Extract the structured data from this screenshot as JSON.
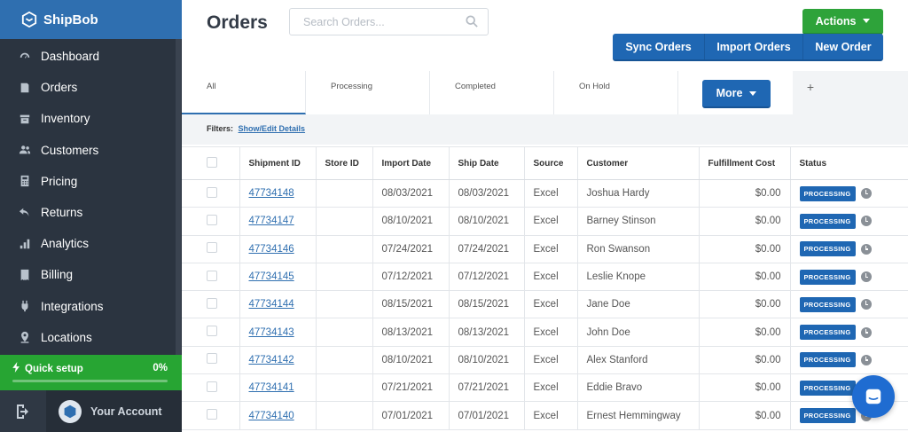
{
  "brand": {
    "name": "ShipBob"
  },
  "sidebar": {
    "items": [
      {
        "label": "Dashboard",
        "icon": "gauge-icon"
      },
      {
        "label": "Orders",
        "icon": "orders-icon"
      },
      {
        "label": "Inventory",
        "icon": "box-icon"
      },
      {
        "label": "Customers",
        "icon": "users-icon"
      },
      {
        "label": "Pricing",
        "icon": "calculator-icon"
      },
      {
        "label": "Returns",
        "icon": "return-arrow-icon"
      },
      {
        "label": "Analytics",
        "icon": "bar-chart-icon"
      },
      {
        "label": "Billing",
        "icon": "receipt-icon"
      },
      {
        "label": "Integrations",
        "icon": "plug-icon"
      },
      {
        "label": "Locations",
        "icon": "location-pin-icon"
      }
    ],
    "quick_setup": {
      "label": "Quick setup",
      "percent_text": "0%",
      "progress": 0
    },
    "account": {
      "label": "Your Account"
    }
  },
  "header": {
    "title": "Orders",
    "search_placeholder": "Search Orders...",
    "actions_label": "Actions",
    "sync_label": "Sync Orders",
    "import_label": "Import Orders",
    "new_label": "New Order"
  },
  "tabs": {
    "all": "All",
    "processing": "Processing",
    "completed": "Completed",
    "on_hold": "On Hold",
    "more": "More",
    "add": "+"
  },
  "filters": {
    "label": "Filters:",
    "link": "Show/Edit Details"
  },
  "table": {
    "columns": [
      "Shipment ID",
      "Store ID",
      "Import Date",
      "Ship Date",
      "Source",
      "Customer",
      "Fulfillment Cost",
      "Status"
    ],
    "rows": [
      {
        "shipment_id": "47734148",
        "store_id": "",
        "import_date": "08/03/2021",
        "ship_date": "08/03/2021",
        "source": "Excel",
        "customer": "Joshua Hardy",
        "cost": "$0.00",
        "status": "PROCESSING"
      },
      {
        "shipment_id": "47734147",
        "store_id": "",
        "import_date": "08/10/2021",
        "ship_date": "08/10/2021",
        "source": "Excel",
        "customer": "Barney Stinson",
        "cost": "$0.00",
        "status": "PROCESSING"
      },
      {
        "shipment_id": "47734146",
        "store_id": "",
        "import_date": "07/24/2021",
        "ship_date": "07/24/2021",
        "source": "Excel",
        "customer": "Ron Swanson",
        "cost": "$0.00",
        "status": "PROCESSING"
      },
      {
        "shipment_id": "47734145",
        "store_id": "",
        "import_date": "07/12/2021",
        "ship_date": "07/12/2021",
        "source": "Excel",
        "customer": "Leslie Knope",
        "cost": "$0.00",
        "status": "PROCESSING"
      },
      {
        "shipment_id": "47734144",
        "store_id": "",
        "import_date": "08/15/2021",
        "ship_date": "08/15/2021",
        "source": "Excel",
        "customer": "Jane Doe",
        "cost": "$0.00",
        "status": "PROCESSING"
      },
      {
        "shipment_id": "47734143",
        "store_id": "",
        "import_date": "08/13/2021",
        "ship_date": "08/13/2021",
        "source": "Excel",
        "customer": "John Doe",
        "cost": "$0.00",
        "status": "PROCESSING"
      },
      {
        "shipment_id": "47734142",
        "store_id": "",
        "import_date": "08/10/2021",
        "ship_date": "08/10/2021",
        "source": "Excel",
        "customer": "Alex Stanford",
        "cost": "$0.00",
        "status": "PROCESSING"
      },
      {
        "shipment_id": "47734141",
        "store_id": "",
        "import_date": "07/21/2021",
        "ship_date": "07/21/2021",
        "source": "Excel",
        "customer": "Eddie Bravo",
        "cost": "$0.00",
        "status": "PROCESSING"
      },
      {
        "shipment_id": "47734140",
        "store_id": "",
        "import_date": "07/01/2021",
        "ship_date": "07/01/2021",
        "source": "Excel",
        "customer": "Ernest Hemmingway",
        "cost": "$0.00",
        "status": "PROCESSING"
      }
    ]
  },
  "colors": {
    "brand_blue": "#2f6fb0",
    "sidebar_bg": "#2b3440",
    "action_green": "#2ea33a",
    "button_blue": "#1f67b3"
  }
}
